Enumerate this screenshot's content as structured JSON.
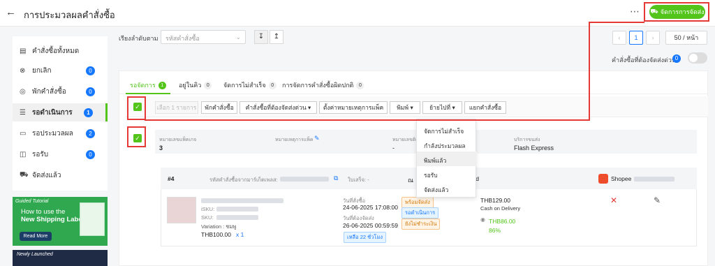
{
  "header": {
    "back_icon": "arrow-left-icon",
    "title": "การประมวลผลคำสั่งซื้อ",
    "more_icon": "more-dots-icon",
    "ship_button": "จัดการการจัดส่ง",
    "ship_icon": "truck-icon"
  },
  "sidebar": {
    "items": [
      {
        "label": "คำสั่งซื้อทั้งหมด",
        "icon": "box-icon",
        "count": null
      },
      {
        "label": "ยกเลิก",
        "icon": "cancel-circle-icon",
        "count": "0"
      },
      {
        "label": "พักคำสั่งซื้อ",
        "icon": "pause-circle-icon",
        "count": "0"
      },
      {
        "label": "รอดำเนินการ",
        "icon": "layers-icon",
        "count": "1"
      },
      {
        "label": "รอประมวลผล",
        "icon": "document-icon",
        "count": "2"
      },
      {
        "label": "รอรับ",
        "icon": "package-icon",
        "count": "0"
      },
      {
        "label": "จัดส่งแล้ว",
        "icon": "truck-icon",
        "count": null
      }
    ],
    "active_index": 3
  },
  "banners": {
    "tutorial_tag": "Guided Tutorial",
    "line1": "How to use the",
    "line2": "New Shipping Label?",
    "read_more": "Read More",
    "newly_launched": "Newly Launched"
  },
  "sort": {
    "label": "เรียงลำดับตาม",
    "select_placeholder": "รหัสคำสั่งซื้อ"
  },
  "pager": {
    "current_page": "1",
    "per_page": "50 / หน้า"
  },
  "urgent": {
    "label": "คำสั่งซื้อที่ต้องจัดส่งด่วน",
    "count": "0"
  },
  "tabs": [
    {
      "label": "รอจัดการ",
      "count": "1"
    },
    {
      "label": "อยู่ในคิว",
      "count": "0"
    },
    {
      "label": "จัดการไม่สำเร็จ",
      "count": "0"
    },
    {
      "label": "การจัดการคำสั่งซื้อผิดปกติ",
      "count": "0"
    }
  ],
  "actions": {
    "selected": "เลือก 1 รายการ",
    "hold": "พักคำสั่งซื้อ",
    "urgent": "คำสั่งซื้อที่ต้องจัดส่งด่วน",
    "set_pack_note": "ตั้งค่าหมายเหตุการแพ็ค",
    "print": "พิมพ์",
    "move_to": "ย้ายไปที่",
    "split": "แยกคำสั่งซื้อ"
  },
  "package": {
    "pkg_no_label": "หมายเลขแพ็คเกจ",
    "pkg_no": "3",
    "pack_note_label": "หมายเหตุการแพ็ค",
    "tracking_label": "หมายเลขติด",
    "tracking_value": "-",
    "carrier_label": "บริการขนส่ง",
    "carrier": "Flash Express"
  },
  "dropdown": {
    "items": [
      "จัดการไม่สำเร็จ",
      "กำลังประมวลผล",
      "พิมพ์แล้ว",
      "รอรับ",
      "จัดส่งแล้ว"
    ],
    "hover_index": 2
  },
  "order": {
    "number": "#4",
    "marketplace_id_label": "รหัสคำสั่งซื้อจากมาร์เก็ตเพลส:",
    "invoice_label": "ใบเสร็จ: -",
    "location_partial": "ณ",
    "location_suffix": "iland",
    "platform": "Shopee",
    "sku_label": "iSKU:",
    "sku2_label": "SKU:",
    "variation": "Variation : ชมพู",
    "price": "THB100.00",
    "qty": "x 1",
    "order_date_label": "วันที่สั่งซื้อ",
    "order_date": "24-06-2025 17:08:00",
    "ship_by_label": "วันที่ต้องจัดส่ง",
    "ship_by": "26-06-2025 00:59:59",
    "remaining": "เหลือ 22 ชั่วโมง",
    "badges": [
      "พร้อมจัดส่ง",
      "รอดำเนินการ",
      "ยังไม่ชำระเงิน"
    ],
    "total": "THB129.00",
    "payment": "Cash on Delivery",
    "profit": "THB86.00",
    "profit_pct": "86%"
  },
  "colors": {
    "primary_green": "#52c41a",
    "highlight_red": "#e53935",
    "badge_blue": "#1677ff"
  }
}
